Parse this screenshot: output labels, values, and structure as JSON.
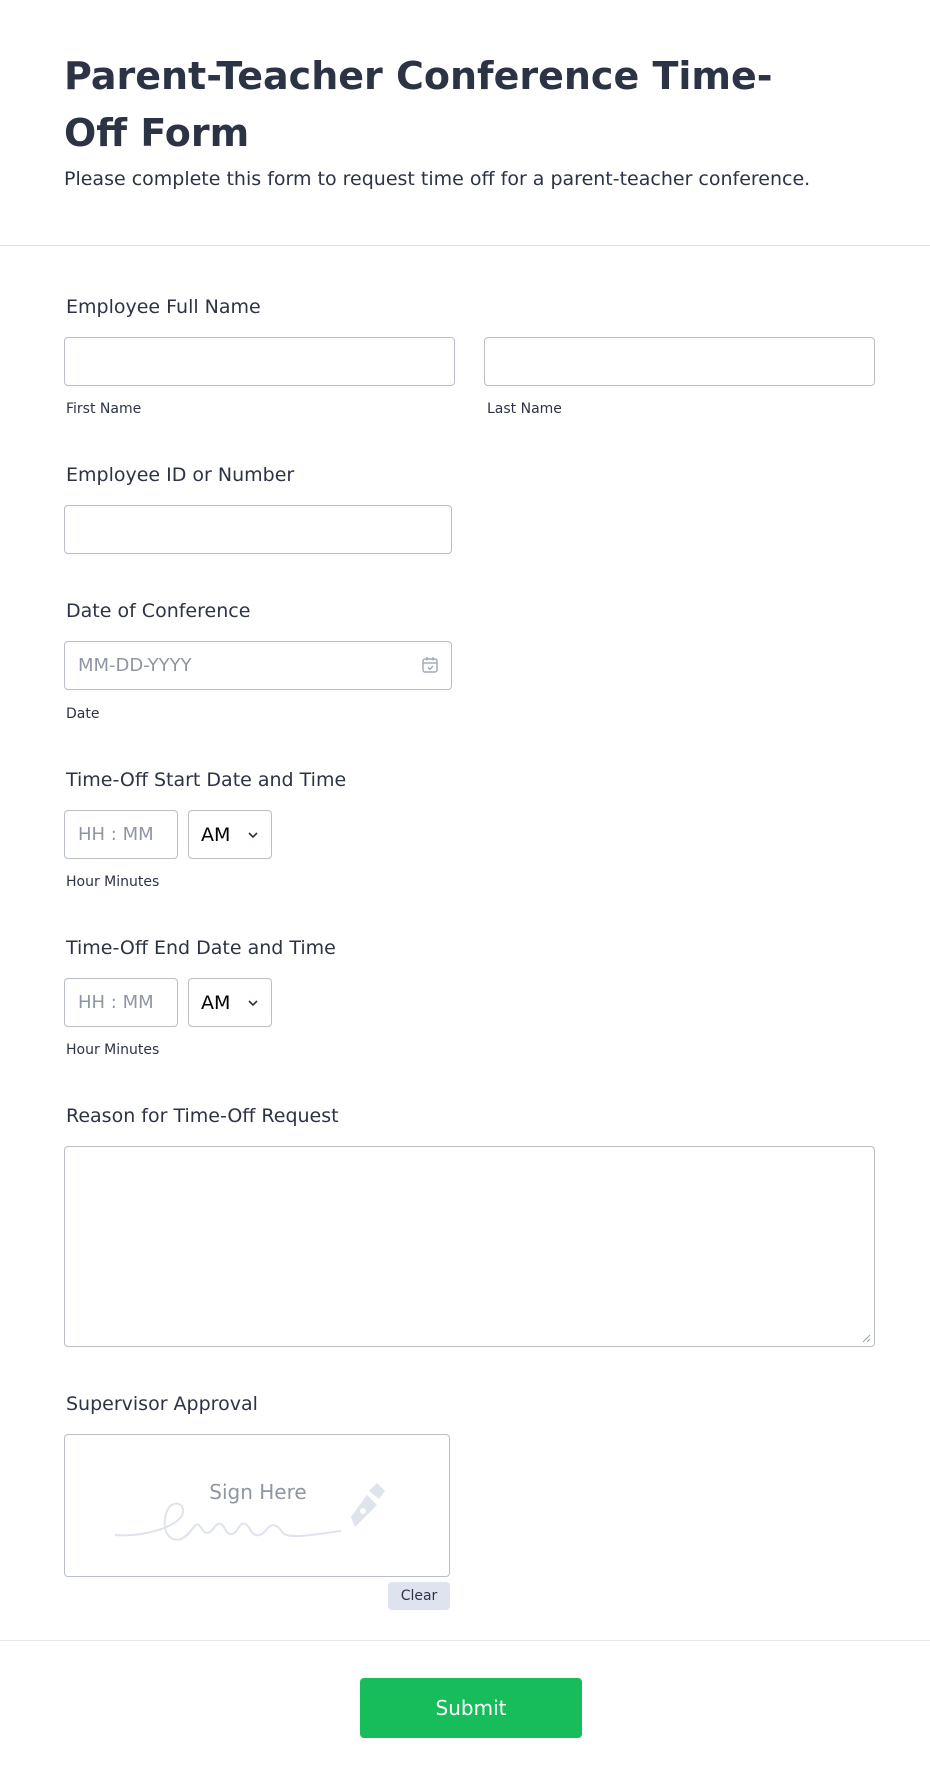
{
  "header": {
    "title": "Parent-Teacher Conference Time-Off Form",
    "subtitle": "Please complete this form to request time off for a parent-teacher conference."
  },
  "employee_name": {
    "label": "Employee Full Name",
    "first_sublabel": "First Name",
    "last_sublabel": "Last Name",
    "first_value": "",
    "last_value": ""
  },
  "employee_id": {
    "label": "Employee ID or Number",
    "value": ""
  },
  "conference_date": {
    "label": "Date of Conference",
    "placeholder": "MM-DD-YYYY",
    "sublabel": "Date",
    "icon": "calendar-icon"
  },
  "start_time": {
    "label": "Time-Off Start Date and Time",
    "placeholder": "HH : MM",
    "ampm": "AM",
    "sublabel": "Hour Minutes"
  },
  "end_time": {
    "label": "Time-Off End Date and Time",
    "placeholder": "HH : MM",
    "ampm": "AM",
    "sublabel": "Hour Minutes"
  },
  "reason": {
    "label": "Reason for Time-Off Request",
    "value": ""
  },
  "approval": {
    "label": "Supervisor Approval",
    "sign_prompt": "Sign Here",
    "clear_label": "Clear",
    "icon": "pen-nib-icon"
  },
  "submit": {
    "label": "Submit",
    "color": "#18bd5b"
  }
}
